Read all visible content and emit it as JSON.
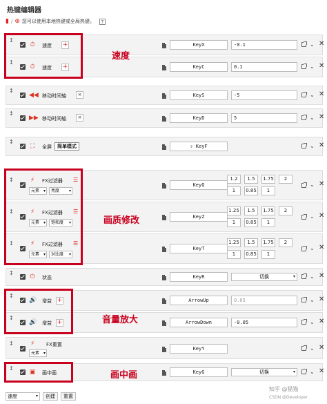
{
  "header": {
    "title": "热键编辑器",
    "notice": "您可以使用本地热键或全局热键。",
    "help_glyph": "?"
  },
  "rows": [
    {
      "label": "速度",
      "key": "KeyX",
      "value": "-0.1"
    },
    {
      "label": "速度",
      "key": "KeyC",
      "value": "0.1"
    },
    {
      "label": "移动时间轴",
      "key": "KeyS",
      "value": "-5"
    },
    {
      "label": "移动时间轴",
      "key": "KeyD",
      "value": "5"
    },
    {
      "label": "全屏",
      "mode_button": "简单模式",
      "key": "⇧ KeyF"
    },
    {
      "label": "FX过滤器",
      "sel1": "元素",
      "sel2": "亮度",
      "key": "KeyQ",
      "nums": [
        "1.2",
        "1.5",
        "1.75",
        "2",
        "1",
        "0.85",
        "1"
      ]
    },
    {
      "label": "FX过滤器",
      "sel1": "元素",
      "sel2": "饱和度",
      "key": "KeyZ",
      "nums": [
        "1.25",
        "1.5",
        "1.75",
        "2",
        "1",
        "0.85",
        "1"
      ]
    },
    {
      "label": "FX过滤器",
      "sel1": "元素",
      "sel2": "对比度",
      "key": "KeyT",
      "nums": [
        "1.25",
        "1.5",
        "1.75",
        "2",
        "1",
        "0.85",
        "1"
      ]
    },
    {
      "label": "状态",
      "key": "KeyR",
      "select": "切换"
    },
    {
      "label": "增益",
      "key": "ArrowUp",
      "placeholder": "0.05"
    },
    {
      "label": "增益",
      "key": "ArrowDown",
      "value": "-0.05"
    },
    {
      "label": "FX重置",
      "sel1": "元素",
      "key": "KeyY"
    },
    {
      "label": "画中画",
      "key": "KeyG",
      "select": "切换"
    }
  ],
  "annotations": {
    "speed": "速度",
    "quality": "画质修改",
    "volume": "音量放大",
    "pip": "画中画"
  },
  "footer": {
    "select": "速度",
    "create": "创建",
    "reset": "重置"
  },
  "watermark": {
    "zhihu": "知乎 @猫猫",
    "csdn": "CSDN @Developer"
  },
  "colors": {
    "accent_red": "#c8001e",
    "icon_red": "#dd3322"
  }
}
